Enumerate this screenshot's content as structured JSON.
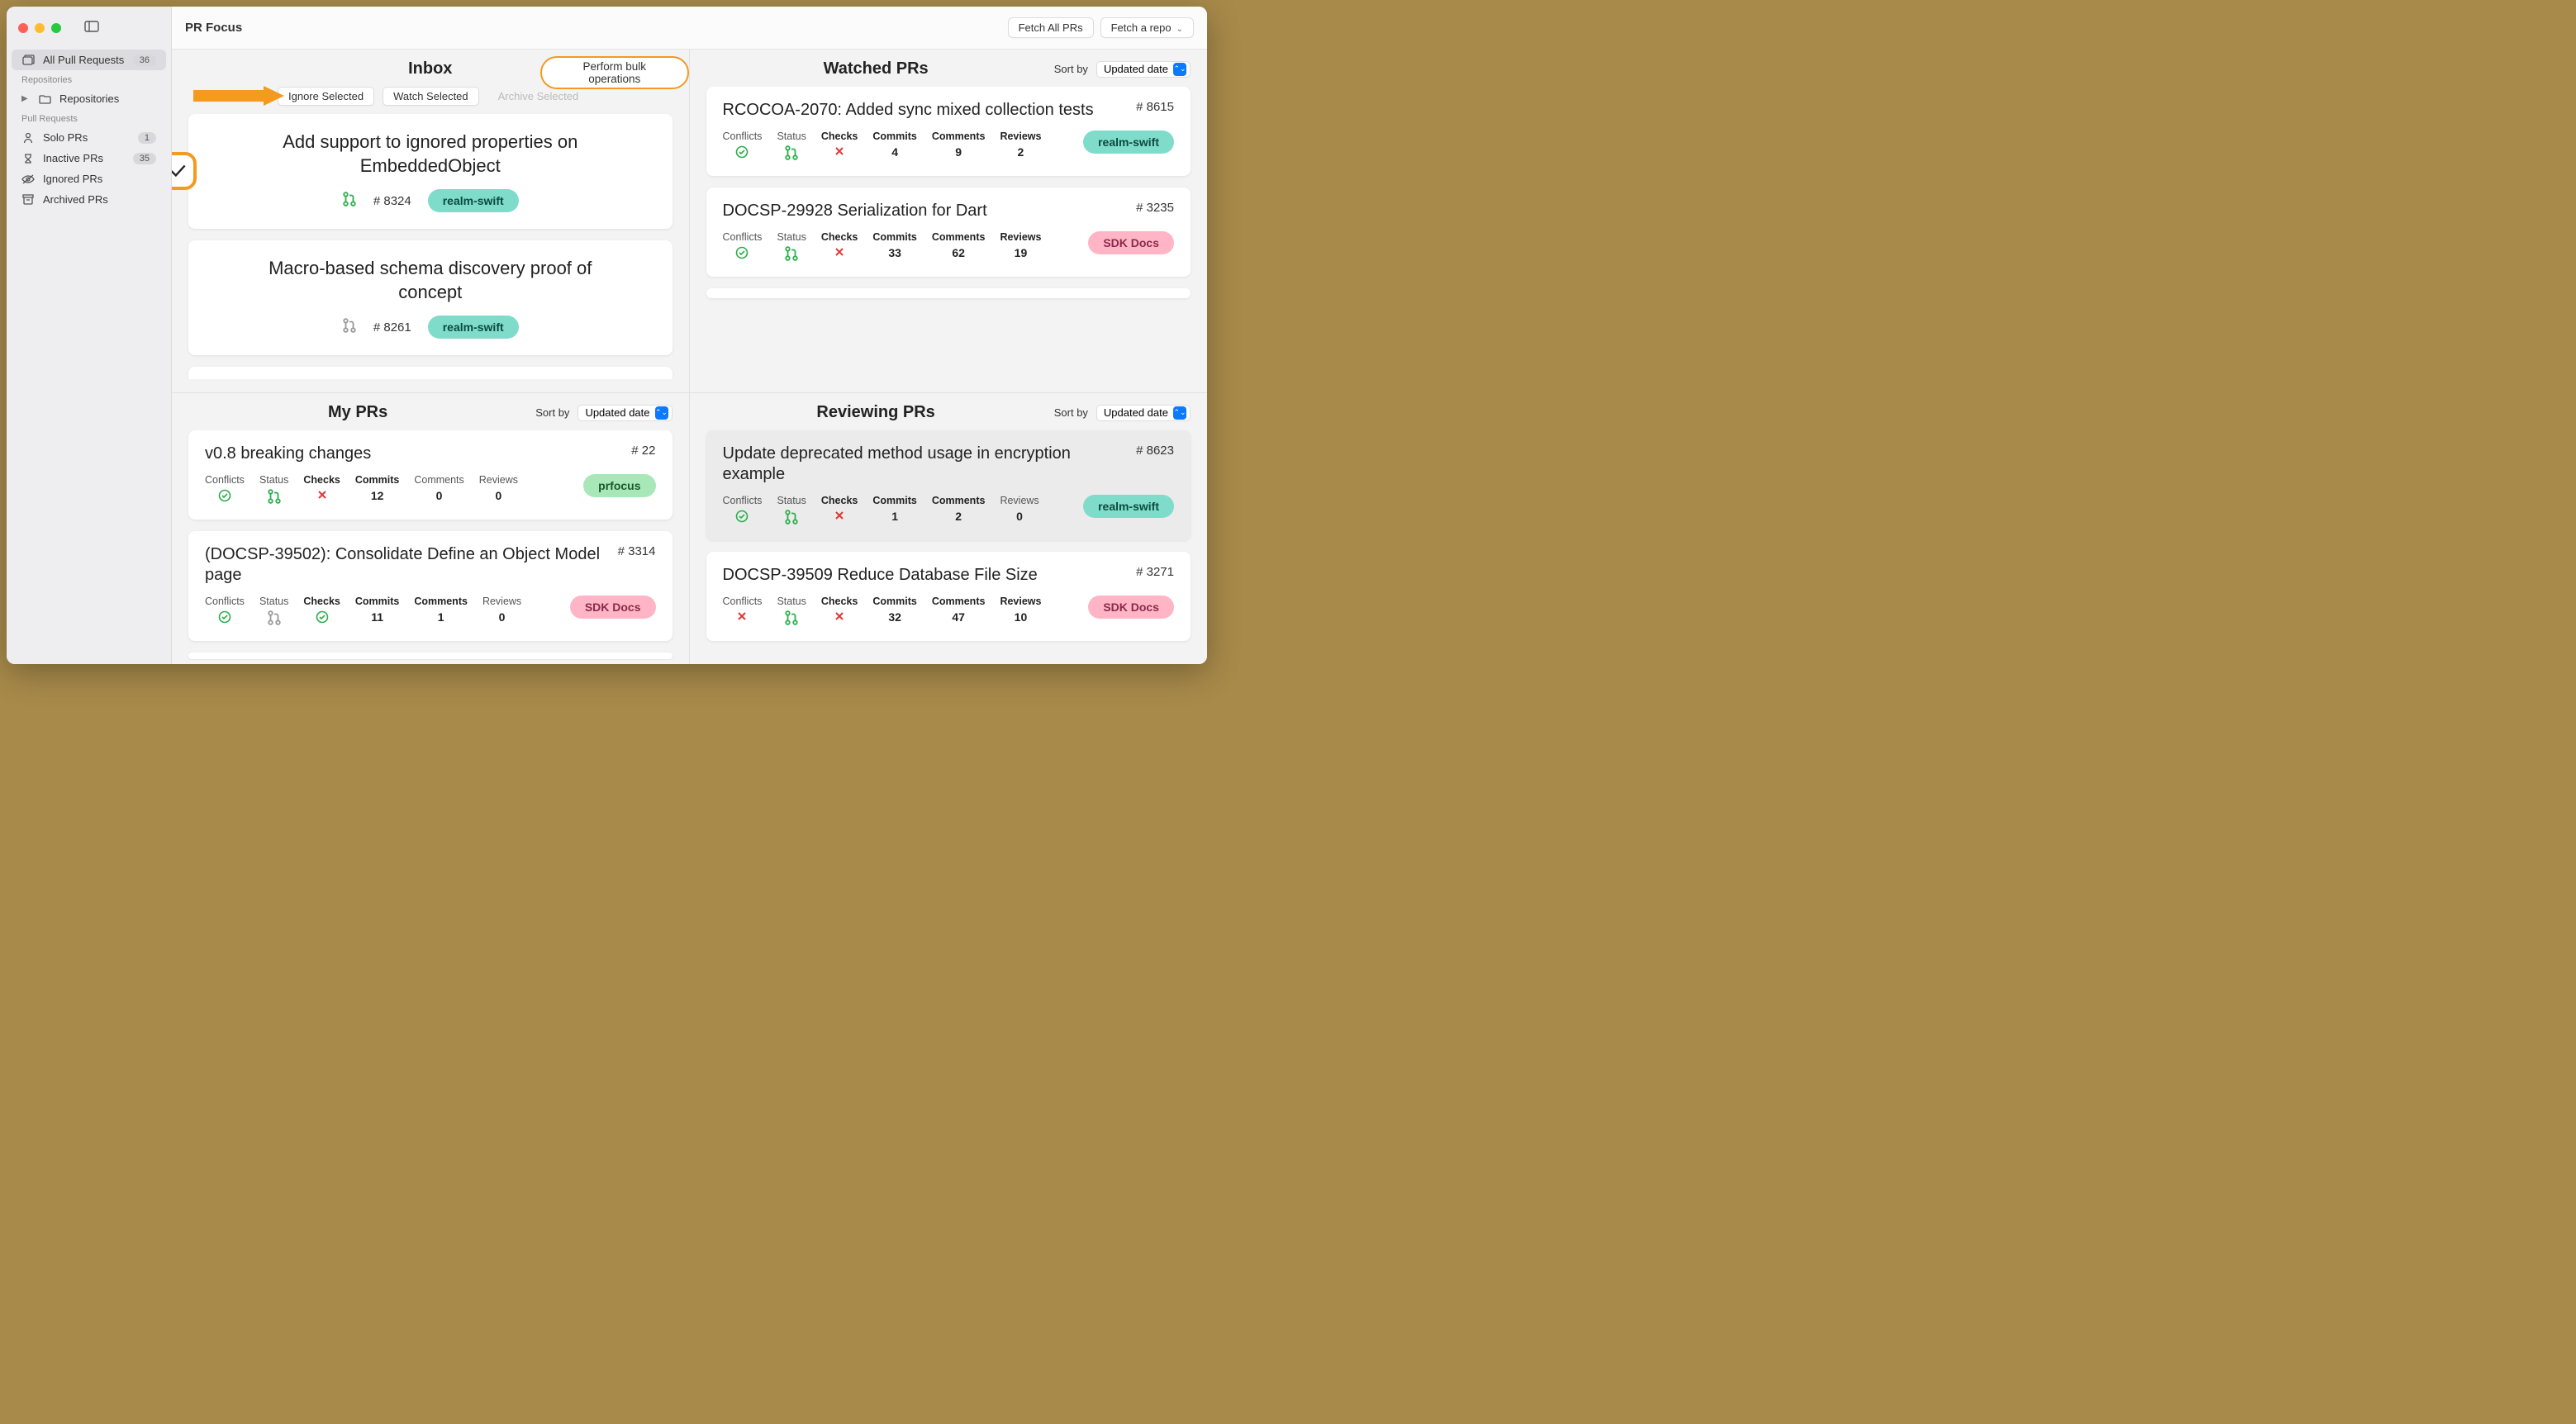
{
  "window": {
    "title": "PR Focus"
  },
  "toolbar": {
    "fetch_all": "Fetch All PRs",
    "fetch_repo": "Fetch a repo"
  },
  "sidebar": {
    "all_prs": {
      "label": "All Pull Requests",
      "count": "36"
    },
    "repos_head": "Repositories",
    "repos_item": "Repositories",
    "prs_head": "Pull Requests",
    "items": [
      {
        "icon": "solo",
        "label": "Solo PRs",
        "count": "1"
      },
      {
        "icon": "inactive",
        "label": "Inactive PRs",
        "count": "35"
      },
      {
        "icon": "ignored",
        "label": "Ignored PRs",
        "count": ""
      },
      {
        "icon": "archived",
        "label": "Archived PRs",
        "count": ""
      }
    ]
  },
  "sort": {
    "label": "Sort by",
    "value": "Updated date"
  },
  "inbox": {
    "title": "Inbox",
    "bulk_toggle": "Perform bulk operations",
    "buttons": {
      "ignore": "Ignore Selected",
      "watch": "Watch Selected",
      "archive": "Archive Selected"
    },
    "cards": [
      {
        "title": "Add support to ignored properties on EmbeddedObject",
        "number": "# 8324",
        "repo": "realm-swift",
        "pill": "teal",
        "open": true,
        "checked": true
      },
      {
        "title": "Macro-based schema discovery proof of concept",
        "number": "# 8261",
        "repo": "realm-swift",
        "pill": "teal",
        "open": false,
        "checked": false
      }
    ]
  },
  "watched": {
    "title": "Watched PRs",
    "cards": [
      {
        "title": "RCOCOA-2070: Added sync mixed collection tests",
        "number": "# 8615",
        "repo": "realm-swift",
        "pill": "teal",
        "conflicts": "ok",
        "status": "open",
        "checks": "fail",
        "commits": "4",
        "comments": "9",
        "reviews": "2"
      },
      {
        "title": "DOCSP-29928 Serialization for Dart",
        "number": "# 3235",
        "repo": "SDK Docs",
        "pill": "pink",
        "conflicts": "ok",
        "status": "open",
        "checks": "fail",
        "commits": "33",
        "comments": "62",
        "reviews": "19"
      }
    ]
  },
  "my_prs": {
    "title": "My PRs",
    "cards": [
      {
        "title": "v0.8 breaking changes",
        "number": "# 22",
        "repo": "prfocus",
        "pill": "green",
        "conflicts": "ok",
        "status": "open",
        "checks": "fail",
        "commits": "12",
        "comments": "0",
        "reviews": "0"
      },
      {
        "title": "(DOCSP-39502): Consolidate Define an Object Model page",
        "number": "# 3314",
        "repo": "SDK Docs",
        "pill": "pink",
        "conflicts": "ok",
        "status": "draft",
        "checks": "pass",
        "commits": "11",
        "comments": "1",
        "reviews": "0"
      }
    ]
  },
  "reviewing": {
    "title": "Reviewing PRs",
    "cards": [
      {
        "title": "Update deprecated method usage in encryption example",
        "number": "# 8623",
        "repo": "realm-swift",
        "pill": "teal",
        "selected": true,
        "conflicts": "ok",
        "status": "open",
        "checks": "fail",
        "commits": "1",
        "comments": "2",
        "reviews": "0"
      },
      {
        "title": "DOCSP-39509 Reduce Database File Size",
        "number": "# 3271",
        "repo": "SDK Docs",
        "pill": "pink",
        "conflicts": "fail",
        "status": "open",
        "checks": "fail",
        "commits": "32",
        "comments": "47",
        "reviews": "10"
      }
    ]
  },
  "stat_labels": {
    "conflicts": "Conflicts",
    "status": "Status",
    "checks": "Checks",
    "commits": "Commits",
    "comments": "Comments",
    "reviews": "Reviews"
  }
}
